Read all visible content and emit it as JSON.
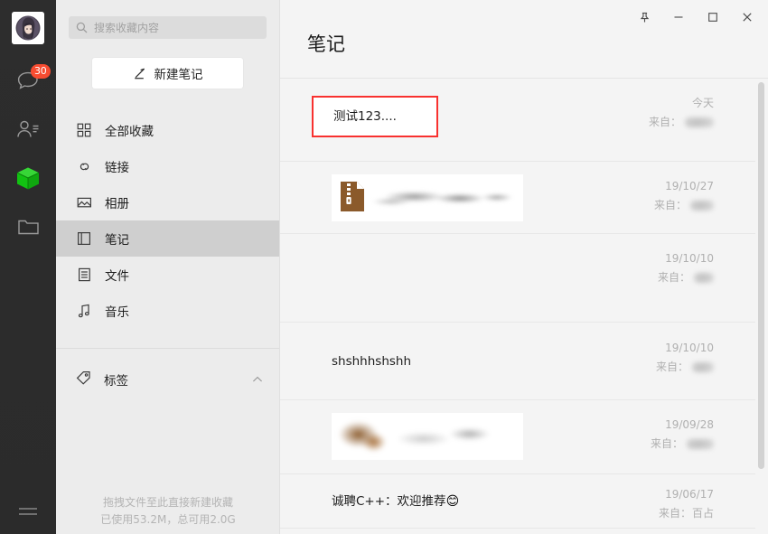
{
  "rail": {
    "avatar_alt": "user-avatar",
    "items": [
      {
        "name": "chat",
        "badge": "30"
      },
      {
        "name": "contacts",
        "badge": ""
      },
      {
        "name": "favorites",
        "badge": ""
      },
      {
        "name": "files",
        "badge": ""
      }
    ],
    "menu_label": "menu",
    "accent_green": "#1bbf1b",
    "badge_color": "#f74c31"
  },
  "sidebar": {
    "search": {
      "placeholder": "搜索收藏内容",
      "value": ""
    },
    "new_note_label": "新建笔记",
    "items": [
      {
        "label": "全部收藏",
        "icon": "grid-icon",
        "selected": false
      },
      {
        "label": "链接",
        "icon": "link-icon",
        "selected": false
      },
      {
        "label": "相册",
        "icon": "image-icon",
        "selected": false
      },
      {
        "label": "笔记",
        "icon": "note-icon",
        "selected": true
      },
      {
        "label": "文件",
        "icon": "file-icon",
        "selected": false
      },
      {
        "label": "音乐",
        "icon": "music-icon",
        "selected": false
      }
    ],
    "tags": {
      "label": "标签",
      "collapsed": false
    },
    "footer": {
      "hint": "拖拽文件至此直接新建收藏",
      "storage": "已使用53.2M，总可用2.0G"
    }
  },
  "titlebar": {
    "pin_label": "置顶",
    "minimize_label": "最小化",
    "maximize_label": "最大化",
    "close_label": "关闭"
  },
  "main": {
    "title": "笔记",
    "from_prefix": "来自：",
    "highlight_color": "#f8312f",
    "rows": [
      {
        "kind": "text-highlighted",
        "text": "测试123....",
        "date": "今天",
        "from_redacted": true,
        "from_width": 32
      },
      {
        "kind": "file-card",
        "file_type": "zip",
        "text": "",
        "date": "19/10/27",
        "from_redacted": true,
        "from_width": 26
      },
      {
        "kind": "blank",
        "text": "",
        "date": "19/10/10",
        "from_redacted": true,
        "from_width": 22
      },
      {
        "kind": "text",
        "text": "shshhhshshh",
        "date": "19/10/10",
        "from_redacted": true,
        "from_width": 24
      },
      {
        "kind": "image-card",
        "text": "",
        "date": "19/09/28",
        "from_redacted": true,
        "from_width": 30
      },
      {
        "kind": "text-emoji",
        "text": "诚聘C++：欢迎推荐 ",
        "emoji": "😊",
        "date": "19/06/17",
        "from_redacted": false,
        "from_text": "百占"
      }
    ]
  }
}
